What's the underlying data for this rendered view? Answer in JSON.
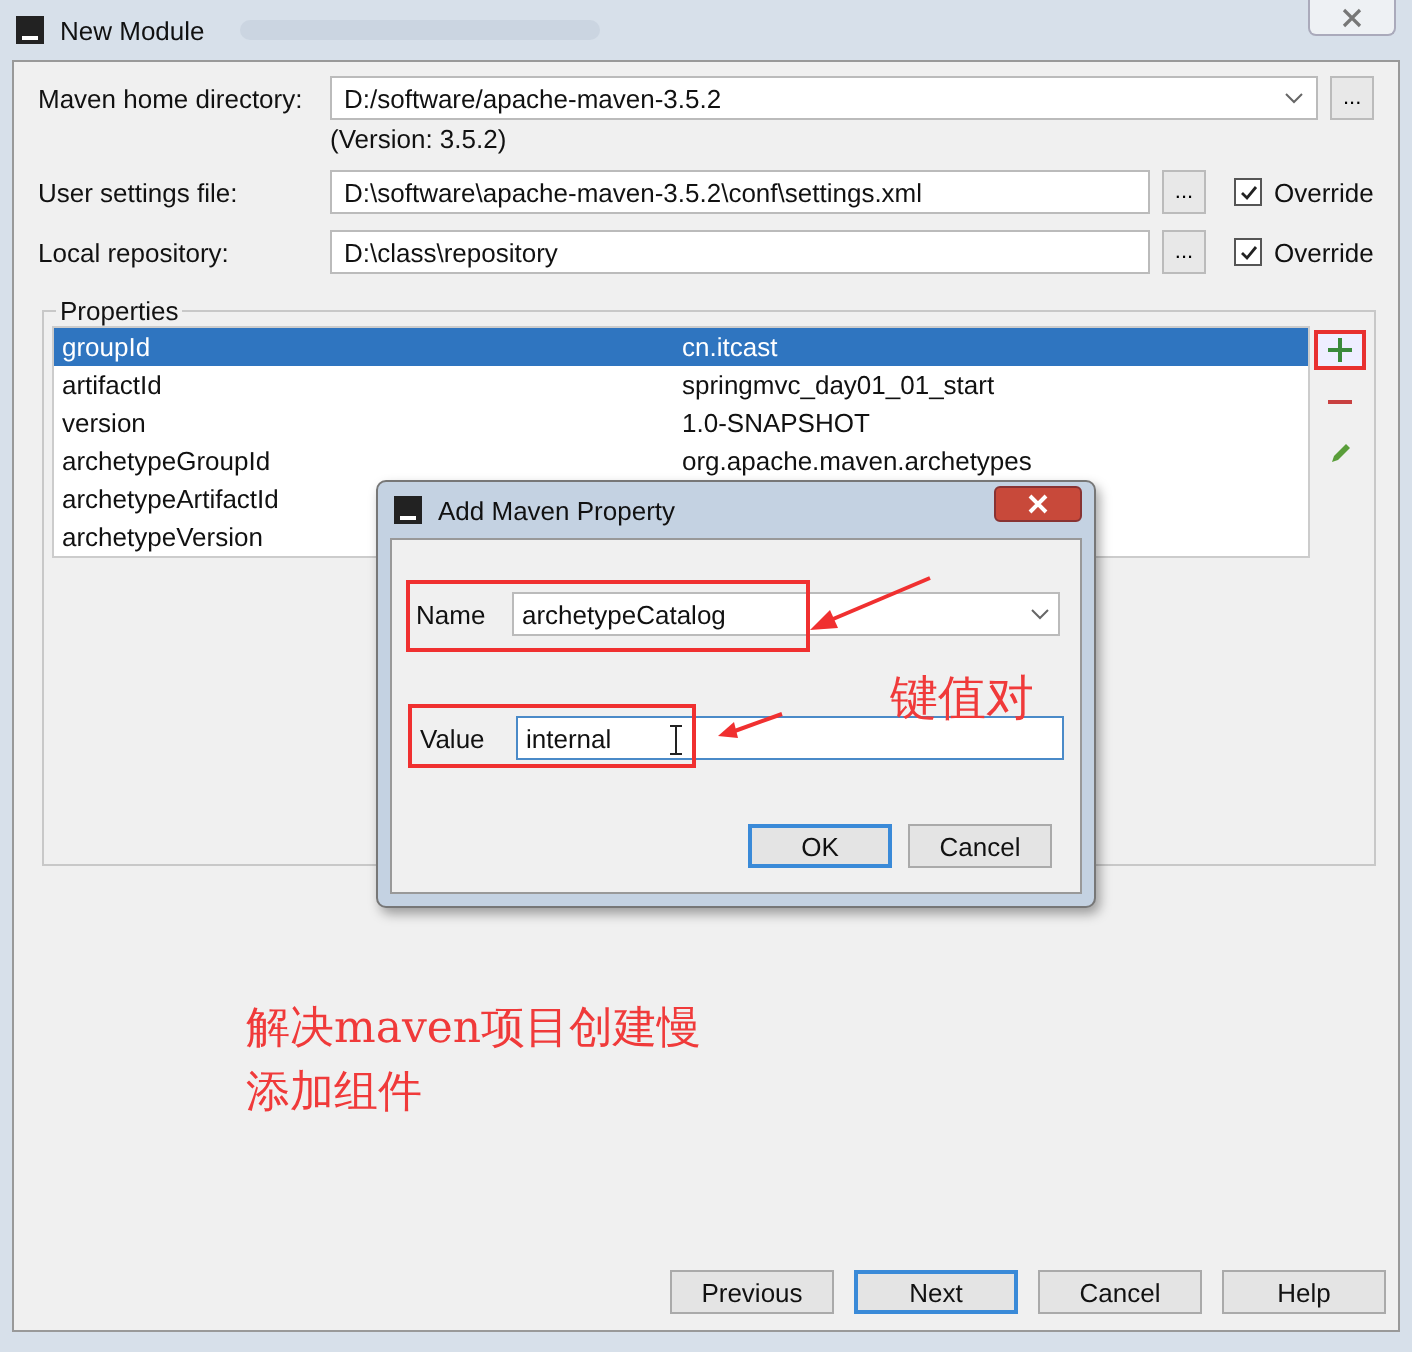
{
  "window": {
    "title": "New Module"
  },
  "fields": [
    {
      "label": "Maven home directory:",
      "value": "D:/software/apache-maven-3.5.2",
      "kind": "combo",
      "note": "(Version: 3.5.2)"
    },
    {
      "label": "User settings file:",
      "value": "D:\\software\\apache-maven-3.5.2\\conf\\settings.xml",
      "kind": "path",
      "override": {
        "label": "Override",
        "checked": true
      }
    },
    {
      "label": "Local repository:",
      "value": "D:\\class\\repository",
      "kind": "path",
      "override": {
        "label": "Override",
        "checked": true
      }
    }
  ],
  "browse_label": "...",
  "properties": {
    "title": "Properties",
    "rows": [
      {
        "name": "groupId",
        "value": "cn.itcast",
        "selected": true
      },
      {
        "name": "artifactId",
        "value": "springmvc_day01_01_start",
        "selected": false
      },
      {
        "name": "version",
        "value": "1.0-SNAPSHOT",
        "selected": false
      },
      {
        "name": "archetypeGroupId",
        "value": "org.apache.maven.archetypes",
        "selected": false
      },
      {
        "name": "archetypeArtifactId",
        "selected": false
      },
      {
        "name": "archetypeVersion",
        "selected": false
      }
    ]
  },
  "dialog": {
    "title": "Add Maven Property",
    "name_label": "Name",
    "name_value": "archetypeCatalog",
    "value_label": "Value",
    "value_value": "internal",
    "buttons": [
      {
        "label": "OK",
        "default": true
      },
      {
        "label": "Cancel",
        "default": false
      }
    ]
  },
  "annotations": {
    "key_value": "键值对",
    "note_lines": [
      "解决maven项目创建慢",
      "添加组件"
    ]
  },
  "buttons": [
    {
      "label": "Previous",
      "default": false
    },
    {
      "label": "Next",
      "default": true
    },
    {
      "label": "Cancel",
      "default": false
    },
    {
      "label": "Help",
      "default": false
    }
  ]
}
